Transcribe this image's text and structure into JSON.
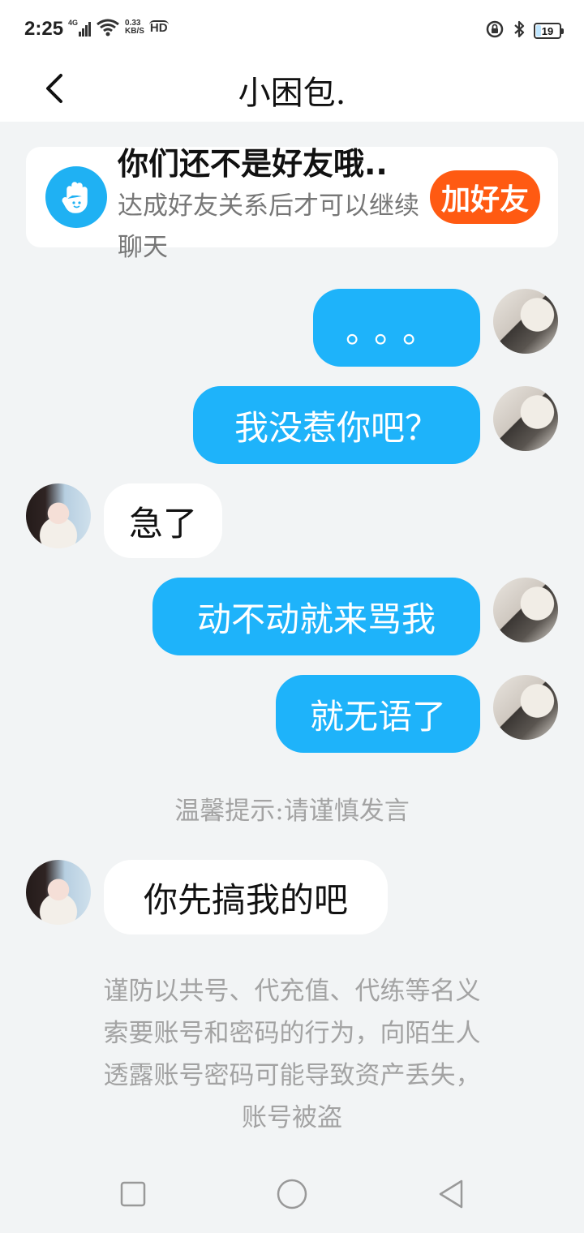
{
  "status_bar": {
    "time": "2:25",
    "network": "4G",
    "speed_value": "0.33",
    "speed_unit": "KB/S",
    "hd": "HD",
    "battery": "19"
  },
  "header": {
    "title": "小困包."
  },
  "friend_card": {
    "title": "你们还不是好友哦..",
    "subtitle": "达成好友关系后才可以继续聊天",
    "button_label": "加好友"
  },
  "messages": [
    {
      "side": "me",
      "text": "。。。"
    },
    {
      "side": "me",
      "text": "我没惹你吧？"
    },
    {
      "side": "other",
      "text": "急了"
    },
    {
      "side": "me",
      "text": "动不动就来骂我"
    },
    {
      "side": "me",
      "text": "就无语了"
    },
    {
      "side": "other",
      "text": "你先搞我的吧"
    }
  ],
  "tip": "温馨提示:请谨慎发言",
  "security_notice": {
    "line1": "谨防以共号、代充值、代练等名义",
    "line2": "索要账号和密码的行为，向陌生人",
    "line3": "透露账号密码可能导致资产丢失，",
    "line4": "账号被盗"
  },
  "colors": {
    "self_bubble": "#1eb3fa",
    "add_button": "#ff5a12",
    "hand_icon_bg": "#1fb1f3",
    "background": "#f2f4f5"
  }
}
